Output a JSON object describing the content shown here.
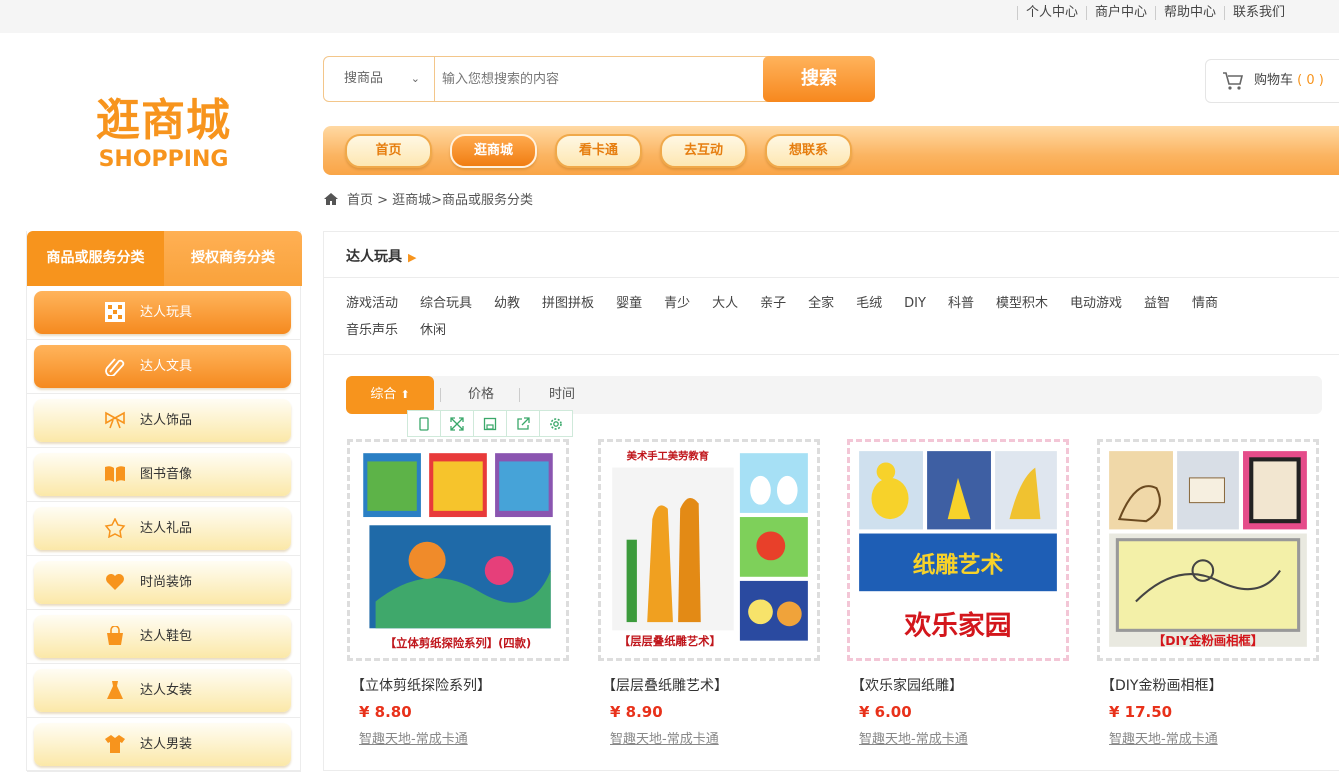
{
  "top_links": [
    "个人中心",
    "商户中心",
    "帮助中心",
    "联系我们"
  ],
  "logo": {
    "cn": "逛商城",
    "en": "SHOPPING"
  },
  "search": {
    "select_value": "搜商品",
    "placeholder": "输入您想搜索的内容",
    "button_label": "搜索"
  },
  "cart": {
    "label": "购物车",
    "count": "( 0 )"
  },
  "nav": [
    {
      "label": "首页",
      "active": false
    },
    {
      "label": "逛商城",
      "active": true
    },
    {
      "label": "看卡通",
      "active": false
    },
    {
      "label": "去互动",
      "active": false
    },
    {
      "label": "想联系",
      "active": false
    }
  ],
  "breadcrumb": "首页 > 逛商城>商品或服务分类",
  "sidebar": {
    "tabs": [
      "商品或服务分类",
      "授权商务分类"
    ],
    "items": [
      {
        "label": "达人玩具",
        "icon": "dice-icon",
        "active": true
      },
      {
        "label": "达人文具",
        "icon": "paperclip-icon",
        "active": true
      },
      {
        "label": "达人饰品",
        "icon": "bow-icon",
        "active": false
      },
      {
        "label": "图书音像",
        "icon": "book-icon",
        "active": false
      },
      {
        "label": "达人礼品",
        "icon": "star-icon",
        "active": false
      },
      {
        "label": "时尚装饰",
        "icon": "heart-icon",
        "active": false
      },
      {
        "label": "达人鞋包",
        "icon": "bag-icon",
        "active": false
      },
      {
        "label": "达人女装",
        "icon": "dress-icon",
        "active": false
      },
      {
        "label": "达人男装",
        "icon": "shirt-icon",
        "active": false
      }
    ]
  },
  "category": {
    "title": "达人玩具",
    "tags": [
      "游戏活动",
      "综合玩具",
      "幼教",
      "拼图拼板",
      "婴童",
      "青少",
      "大人",
      "亲子",
      "全家",
      "毛绒",
      "DIY",
      "科普",
      "模型积木",
      "电动游戏",
      "益智",
      "情商",
      "音乐声乐",
      "休闲"
    ]
  },
  "sort": {
    "options": [
      "综合",
      "价格",
      "时间"
    ],
    "active_arrow": "⬆"
  },
  "products": [
    {
      "name": "【立体剪纸探险系列】",
      "price": "¥ 8.80",
      "shop": "智趣天地-常成卡通",
      "caption": "【立体剪纸探险系列】(四款)"
    },
    {
      "name": "【层层叠纸雕艺术】",
      "price": "¥ 8.90",
      "shop": "智趣天地-常成卡通",
      "caption": "【层层叠纸雕艺术】",
      "header": "美术手工美劳教育"
    },
    {
      "name": "【欢乐家园纸雕】",
      "price": "¥ 6.00",
      "shop": "智趣天地-常成卡通",
      "caption": "欢乐家园",
      "header": "纸雕艺术"
    },
    {
      "name": "【DIY金粉画相框】",
      "price": "¥ 17.50",
      "shop": "智趣天地-常成卡通",
      "caption": "【DIY金粉画相框】"
    }
  ],
  "colors": {
    "accent": "#f7941d",
    "price": "#e8311a"
  }
}
